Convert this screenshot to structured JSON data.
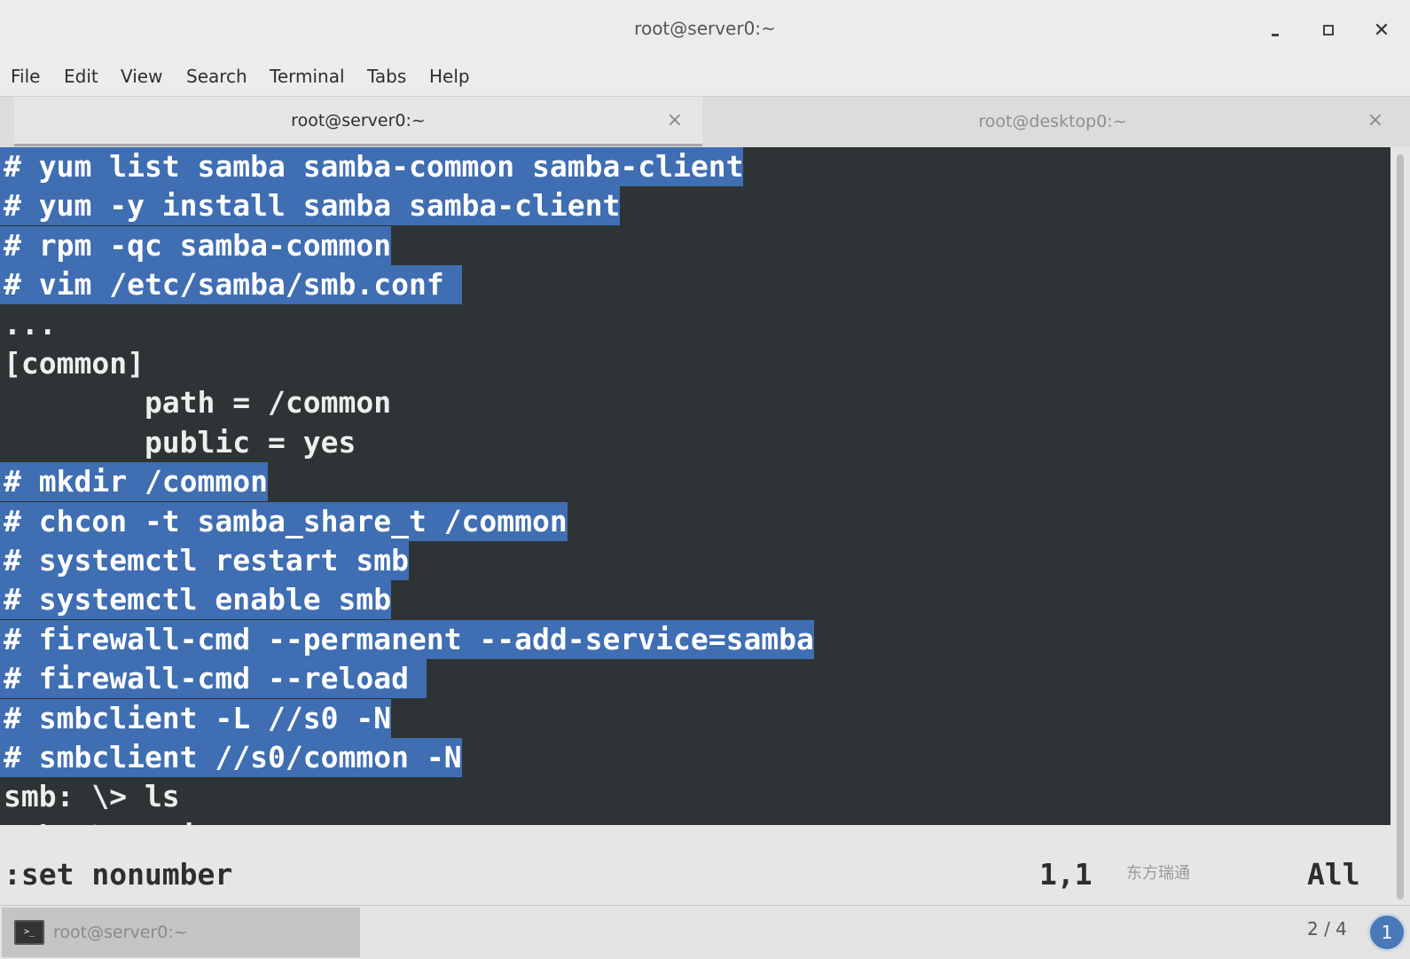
{
  "window": {
    "title": "root@server0:~",
    "min_glyph": "–",
    "max_glyph": "□",
    "close_glyph": "✕"
  },
  "menu": [
    "File",
    "Edit",
    "View",
    "Search",
    "Terminal",
    "Tabs",
    "Help"
  ],
  "tabs": [
    {
      "label": "root@server0:~",
      "close": "×",
      "active": true
    },
    {
      "label": "root@desktop0:~",
      "close": "×",
      "active": false
    }
  ],
  "terminal": {
    "lines": [
      {
        "text": "# yum list samba samba-common samba-client",
        "selected": true
      },
      {
        "text": "# yum -y install samba samba-client",
        "selected": true
      },
      {
        "text": "# rpm -qc samba-common",
        "selected": true
      },
      {
        "text": "# vim /etc/samba/smb.conf ",
        "selected": true
      },
      {
        "text": "...",
        "selected": false
      },
      {
        "text": "[common]",
        "selected": false
      },
      {
        "text": "        path = /common",
        "selected": false
      },
      {
        "text": "        public = yes",
        "selected": false
      },
      {
        "text": "# mkdir /common",
        "selected": true
      },
      {
        "text": "# chcon -t samba_share_t /common",
        "selected": true
      },
      {
        "text": "# systemctl restart smb",
        "selected": true
      },
      {
        "text": "# systemctl enable smb",
        "selected": true
      },
      {
        "text": "# firewall-cmd --permanent --add-service=samba",
        "selected": true
      },
      {
        "text": "# firewall-cmd --reload ",
        "selected": true
      },
      {
        "text": "# smbclient -L //s0 -N",
        "selected": true
      },
      {
        "text": "# smbclient //s0/common -N",
        "selected": true
      },
      {
        "text": "smb: \\> ls",
        "selected": false
      },
      {
        "text": "smb: \\> exit",
        "selected": false
      }
    ],
    "command_line": ":set nonumber",
    "cursor_pos": "1,1",
    "scroll_status": "All"
  },
  "taskbar": {
    "window_label": "root@server0:~",
    "workspace": "2 / 4",
    "notification_count": "1"
  },
  "watermark": "东方瑞通"
}
